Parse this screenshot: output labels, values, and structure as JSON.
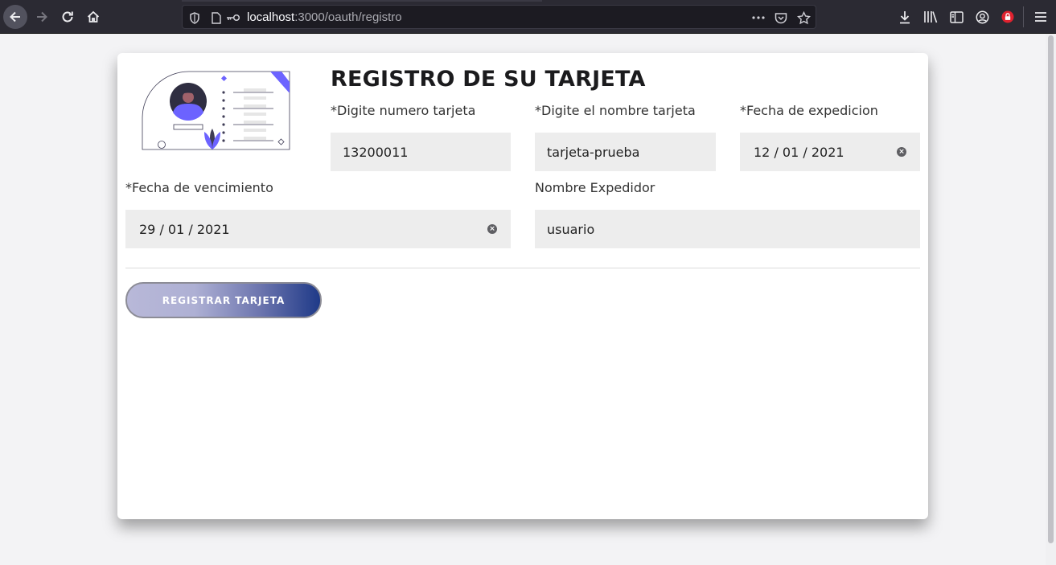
{
  "browser": {
    "url_host": "localhost",
    "url_path": ":3000/oauth/registro",
    "icons": {
      "back": "arrow-left-icon",
      "forward": "arrow-right-icon",
      "reload": "reload-icon",
      "home": "home-icon",
      "shield": "tracking-shield-icon",
      "page": "page-info-icon",
      "key": "key-icon",
      "more": "more-dots-icon",
      "pocket": "pocket-icon",
      "star": "bookmark-star-icon",
      "download": "download-icon",
      "library": "library-icon",
      "sidebar": "sidebar-icon",
      "account": "account-icon",
      "lock": "lock-addon-icon",
      "menu": "hamburger-menu-icon"
    }
  },
  "form": {
    "title": "REGISTRO DE SU TARJETA",
    "fields": {
      "card_number": {
        "label": "*Digite numero tarjeta",
        "value": "13200011"
      },
      "card_name": {
        "label": "*Digite el nombre tarjeta",
        "value": "tarjeta-prueba"
      },
      "issue_date": {
        "label": "*Fecha de expedicion",
        "value": "12 / 01 / 2021"
      },
      "expiry_date": {
        "label": "*Fecha de vencimiento",
        "value": "29 / 01 / 2021"
      },
      "issuer_name": {
        "label": "Nombre Expedidor",
        "value": "usuario"
      }
    },
    "submit_label": "REGISTRAR TARJETA"
  },
  "colors": {
    "accent": "#6c63ff",
    "button_gradient_end": "#1f3a88"
  }
}
